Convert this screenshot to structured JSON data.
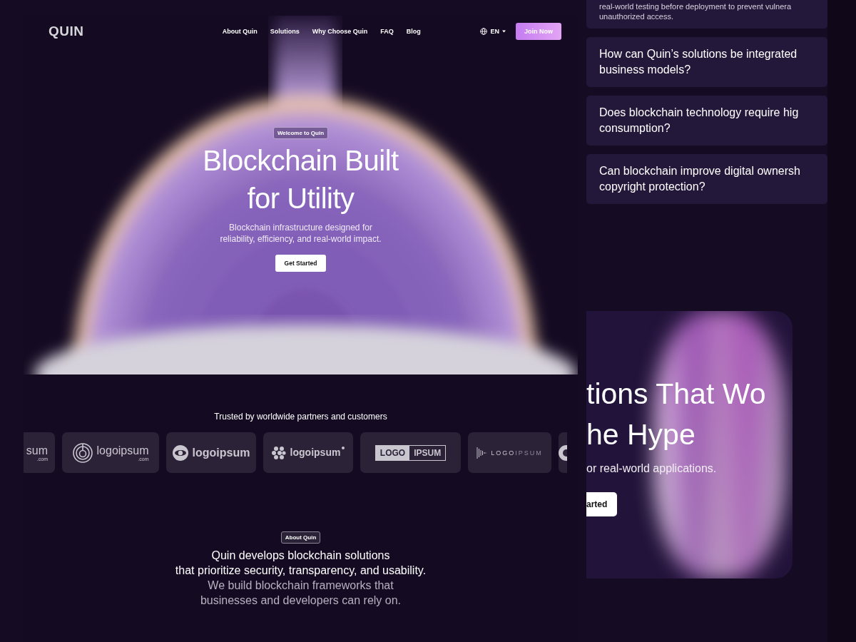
{
  "brand": {
    "logo": "QUIN"
  },
  "nav": {
    "links": [
      "About Quin",
      "Solutions",
      "Why Choose Quin",
      "FAQ",
      "Blog"
    ],
    "language": "EN",
    "cta": "Join Now"
  },
  "hero": {
    "badge": "Welcome to Quin",
    "title_lines": [
      "Blockchain Built",
      "for Utility"
    ],
    "subtitle_lines": [
      "Blockchain infrastructure designed for",
      "reliability, efficiency, and real-world impact."
    ],
    "button": "Get Started"
  },
  "partners": {
    "heading": "Trusted by worldwide partners and customers",
    "logos": [
      {
        "kind": "partial",
        "text": "sum",
        "sub": ".com"
      },
      {
        "kind": "spiral",
        "text": "logoipsum",
        "sub": ".com"
      },
      {
        "kind": "ring",
        "text": "logoipsum"
      },
      {
        "kind": "dots",
        "text": "logoipsum"
      },
      {
        "kind": "boxed",
        "text": "LOGO",
        "text2": "IPSUM"
      },
      {
        "kind": "bars",
        "text": "LOGO",
        "text2": "IPSUM"
      },
      {
        "kind": "cut"
      }
    ]
  },
  "about": {
    "badge": "About Quin",
    "lines": [
      {
        "text": "Quin develops blockchain solutions",
        "muted": false
      },
      {
        "text": "that prioritize security, transparency, and usability.",
        "muted": false
      },
      {
        "text": "We build blockchain frameworks that",
        "muted": true
      },
      {
        "text": "businesses and developers can rely on.",
        "muted": true
      }
    ]
  },
  "faq": {
    "answer_lines": [
      "real-world testing before deployment to prevent vulnera",
      "unauthorized access."
    ],
    "questions": [
      {
        "lines": [
          "How can Quin’s solutions be integrated",
          "business models?"
        ]
      },
      {
        "lines": [
          "Does blockchain technology require hig",
          "consumption?"
        ]
      },
      {
        "lines": [
          "Can blockchain improve digital ownersh",
          "copyright protection?"
        ]
      }
    ]
  },
  "promo": {
    "title_lines": [
      "tions That Wo",
      "he Hype"
    ],
    "subtitle": "or real-world applications.",
    "button": "arted"
  }
}
